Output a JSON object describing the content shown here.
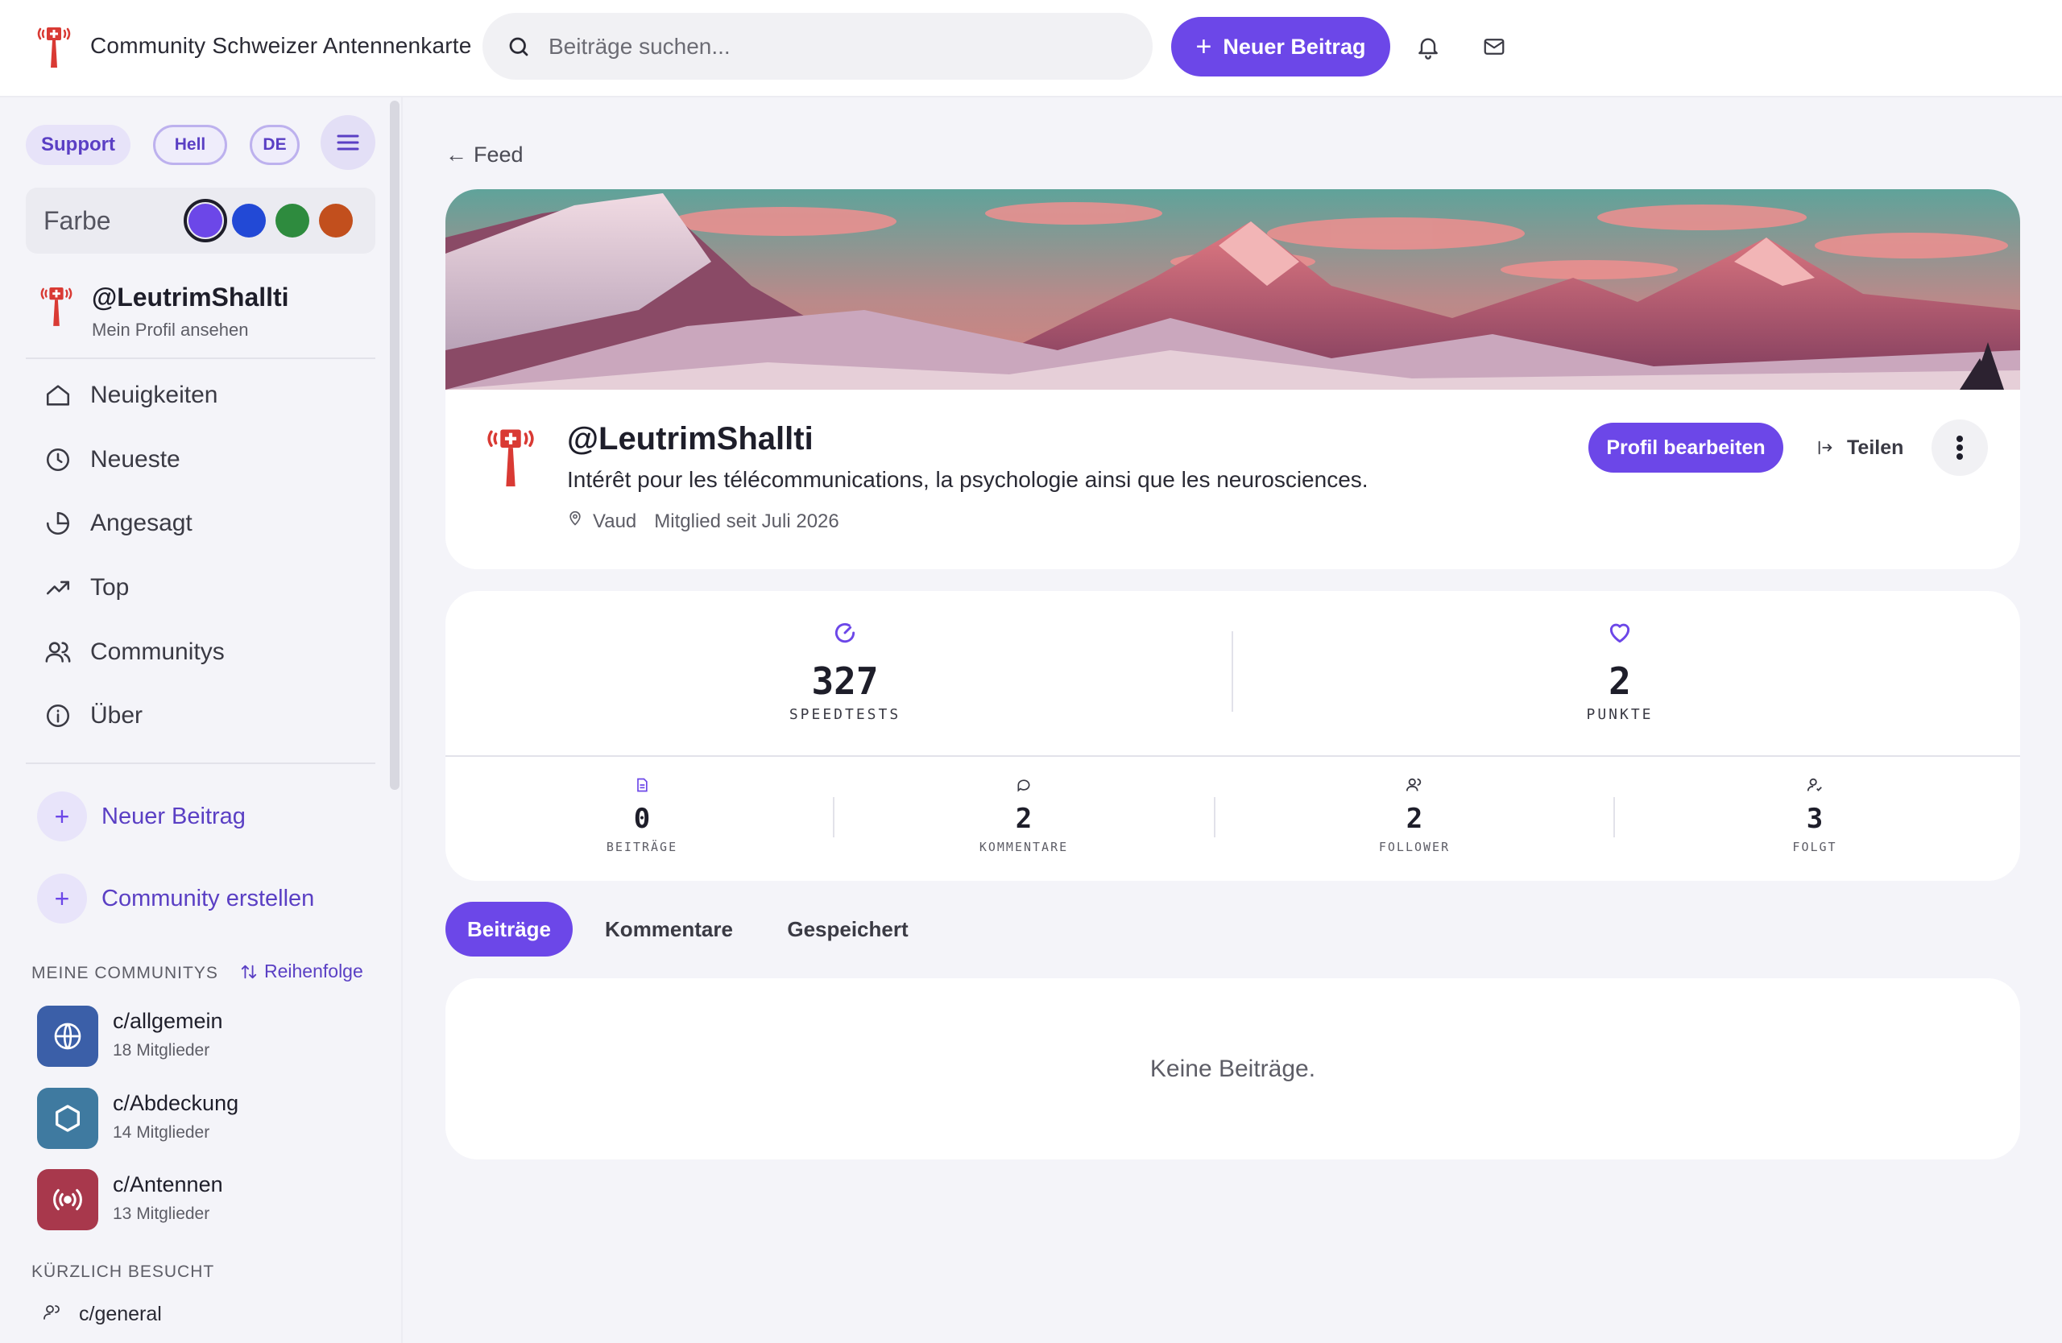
{
  "header": {
    "app_title": "Community Schweizer Antennenkarte",
    "search_placeholder": "Beiträge suchen...",
    "new_post_label": "Neuer Beitrag"
  },
  "sidebar": {
    "support_label": "Support",
    "theme_label": "Hell",
    "language_label": "DE",
    "color_label": "Farbe",
    "colors": [
      "#6c47e8",
      "#2249d6",
      "#2e8b3e",
      "#c24f1d"
    ],
    "profile": {
      "username": "@LeutrimShallti",
      "view_profile": "Mein Profil ansehen"
    },
    "nav_items": [
      {
        "label": "Neuigkeiten",
        "icon": "home-icon"
      },
      {
        "label": "Neueste",
        "icon": "clock-icon"
      },
      {
        "label": "Angesagt",
        "icon": "trending-icon"
      },
      {
        "label": "Top",
        "icon": "chart-up-icon"
      },
      {
        "label": "Communitys",
        "icon": "users-icon"
      },
      {
        "label": "Über",
        "icon": "info-icon"
      }
    ],
    "actions": [
      {
        "label": "Neuer Beitrag"
      },
      {
        "label": "Community erstellen"
      }
    ],
    "my_communities_title": "MEINE COMMUNITYS",
    "reorder_label": "Reihenfolge",
    "communities": [
      {
        "name": "c/allgemein",
        "members": "18 Mitglieder",
        "icon": "globe-icon",
        "color": "#3b5fa8"
      },
      {
        "name": "c/Abdeckung",
        "members": "14 Mitglieder",
        "icon": "hexagon-icon",
        "color": "#3f7aa0"
      },
      {
        "name": "c/Antennen",
        "members": "13 Mitglieder",
        "icon": "broadcast-icon",
        "color": "#a8384c"
      }
    ],
    "recent_title": "KÜRZLICH BESUCHT",
    "recent": [
      {
        "name": "c/general"
      }
    ]
  },
  "main": {
    "back_label": "Feed",
    "profile": {
      "username": "@LeutrimShallti",
      "bio": "Intérêt pour les télécommunications, la psychologie ainsi que les neurosciences.",
      "location": "Vaud",
      "member_since": "Mitglied seit Juli 2026",
      "edit_label": "Profil bearbeiten",
      "share_label": "Teilen"
    },
    "stats_primary": [
      {
        "value": "327",
        "label": "SPEEDTESTS"
      },
      {
        "value": "2",
        "label": "PUNKTE"
      }
    ],
    "stats_secondary": [
      {
        "value": "0",
        "label": "BEITRÄGE"
      },
      {
        "value": "2",
        "label": "KOMMENTARE"
      },
      {
        "value": "2",
        "label": "FOLLOWER"
      },
      {
        "value": "3",
        "label": "FOLGT"
      }
    ],
    "tabs": [
      {
        "label": "Beiträge",
        "active": true
      },
      {
        "label": "Kommentare",
        "active": false
      },
      {
        "label": "Gespeichert",
        "active": false
      }
    ],
    "empty_text": "Keine Beiträge."
  }
}
